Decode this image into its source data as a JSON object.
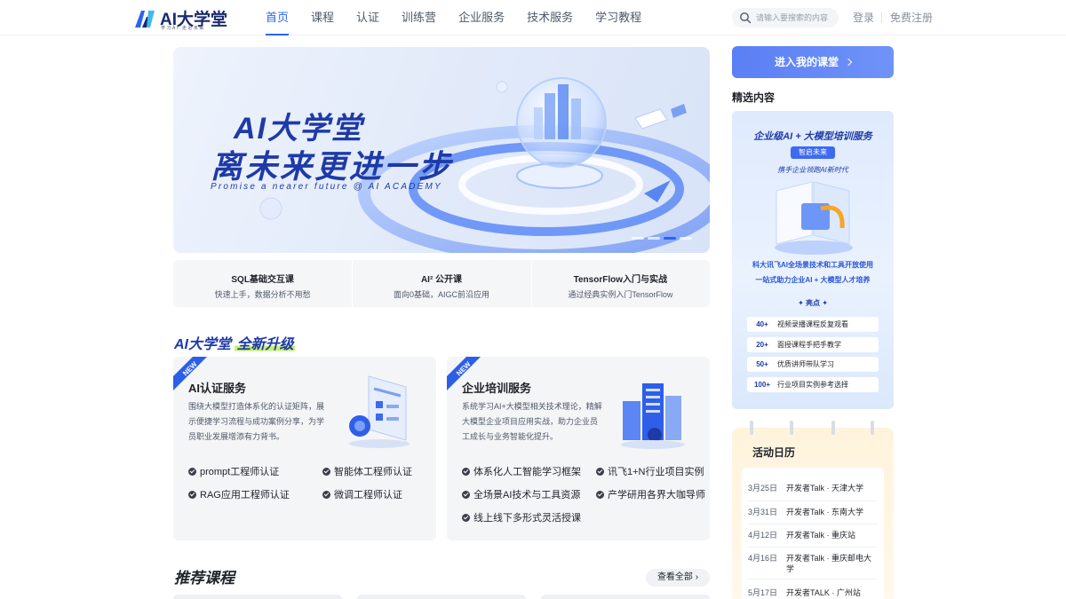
{
  "header": {
    "logo_text": "AI大学堂",
    "logo_sub": "学习AI·走近未来",
    "nav": [
      "首页",
      "课程",
      "认证",
      "训练营",
      "企业服务",
      "技术服务",
      "学习教程"
    ],
    "search_placeholder": "请输入要搜索的内容",
    "login": "登录",
    "register": "免费注册"
  },
  "banner": {
    "title": "AI大学堂",
    "title2": "离未来更进一步",
    "subtitle_en": "Promise a nearer future @ AI ACADEMY",
    "active_slide": 3,
    "slide_count": 4
  },
  "quick_courses": [
    {
      "title": "SQL基础交互课",
      "sub": "快速上手，数据分析不用愁"
    },
    {
      "title": "AI² 公开课",
      "sub": "面向0基础，AIGC前沿应用"
    },
    {
      "title": "TensorFlow入门与实战",
      "sub": "通过经典实例入门TensorFlow"
    }
  ],
  "upgrade": {
    "prefix": "AI大学堂",
    "highlight": "全新升级"
  },
  "services": [
    {
      "tag": "NEW",
      "title": "AI认证服务",
      "desc": "围绕大模型打造体系化的认证矩阵，展示便捷学习流程与成功案例分享，为学员职业发展增添有力背书。",
      "features": [
        "prompt工程师认证",
        "智能体工程师认证",
        "RAG应用工程师认证",
        "微调工程师认证"
      ]
    },
    {
      "tag": "NEW",
      "title": "企业培训服务",
      "desc": "系统学习AI+大模型相关技术理论，精解大模型企业项目应用实战，助力企业员工成长与业务智能化提升。",
      "features": [
        "体系化人工智能学习框架",
        "讯飞1+N行业项目实例",
        "全场景AI技术与工具资源",
        "产学研用各界大咖导师",
        "线上线下多形式灵活授课"
      ]
    }
  ],
  "recommended": {
    "title": "推荐课程",
    "view_all": "查看全部"
  },
  "sidebar": {
    "enter_button": "进入我的课堂",
    "featured_label": "精选内容",
    "promo": {
      "title": "企业级AI + 大模型培训服务",
      "badge": "智启未来",
      "sub": "携手企业领跑AI新时代",
      "line1": "科大讯飞AI全场景技术和工具开放使用",
      "line2": "一站式助力企业AI + 大模型人才培养",
      "highlights_label": "✦ 亮点 ✦",
      "rows": [
        {
          "num": "40+",
          "text": "视频录播课程反复观看"
        },
        {
          "num": "20+",
          "text": "面授课程手把手教学"
        },
        {
          "num": "50+",
          "text": "优质讲师带队学习"
        },
        {
          "num": "100+",
          "text": "行业项目实例参考选择"
        }
      ]
    },
    "calendar": {
      "title": "活动日历",
      "events": [
        {
          "date": "3月25日",
          "event": "开发者Talk · 天津大学"
        },
        {
          "date": "3月31日",
          "event": "开发者Talk · 东南大学"
        },
        {
          "date": "4月12日",
          "event": "开发者Talk · 重庆站"
        },
        {
          "date": "4月16日",
          "event": "开发者Talk · 重庆邮电大学"
        },
        {
          "date": "5月17日",
          "event": "开发者TALK · 广州站"
        }
      ]
    }
  },
  "colors": {
    "accent": "#2b63f6",
    "brand_dark": "#1e3aa8",
    "highlight": "#c6f26b"
  }
}
